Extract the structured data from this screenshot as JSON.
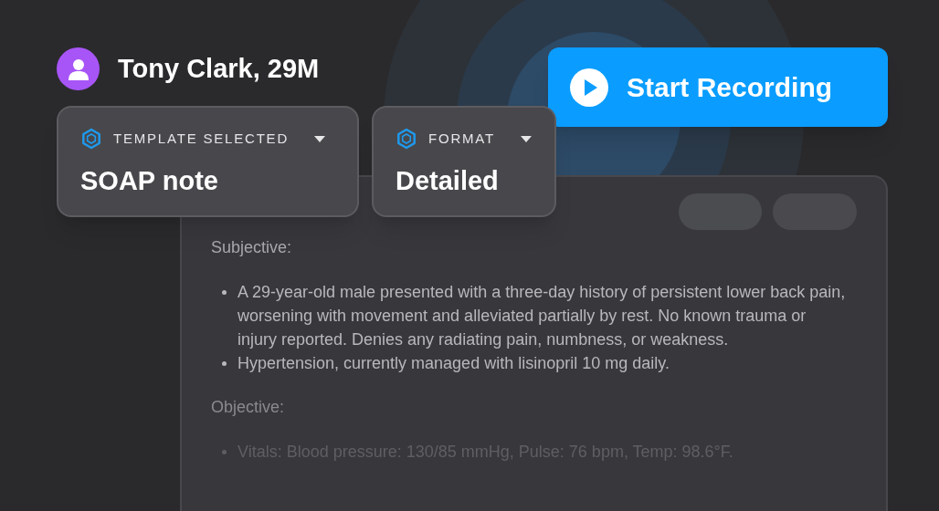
{
  "patient": {
    "name": "Tony Clark, 29M"
  },
  "selectors": [
    {
      "label": "TEMPLATE SELECTED",
      "value": "SOAP note"
    },
    {
      "label": "FORMAT",
      "value": "Detailed"
    }
  ],
  "record_button": {
    "label": "Start Recording"
  },
  "note": {
    "sections": [
      {
        "heading": "Subjective:",
        "items": [
          "A 29-year-old male presented with a three-day history of persistent lower back pain, worsening with movement and alleviated partially by rest. No known trauma or injury reported. Denies any radiating pain, numbness, or weakness.",
          "Hypertension, currently managed with lisinopril 10 mg daily."
        ]
      },
      {
        "heading": "Objective:",
        "items": [
          "Vitals: Blood pressure: 130/85 mmHg, Pulse: 76 bpm, Temp: 98.6°F."
        ]
      }
    ]
  }
}
